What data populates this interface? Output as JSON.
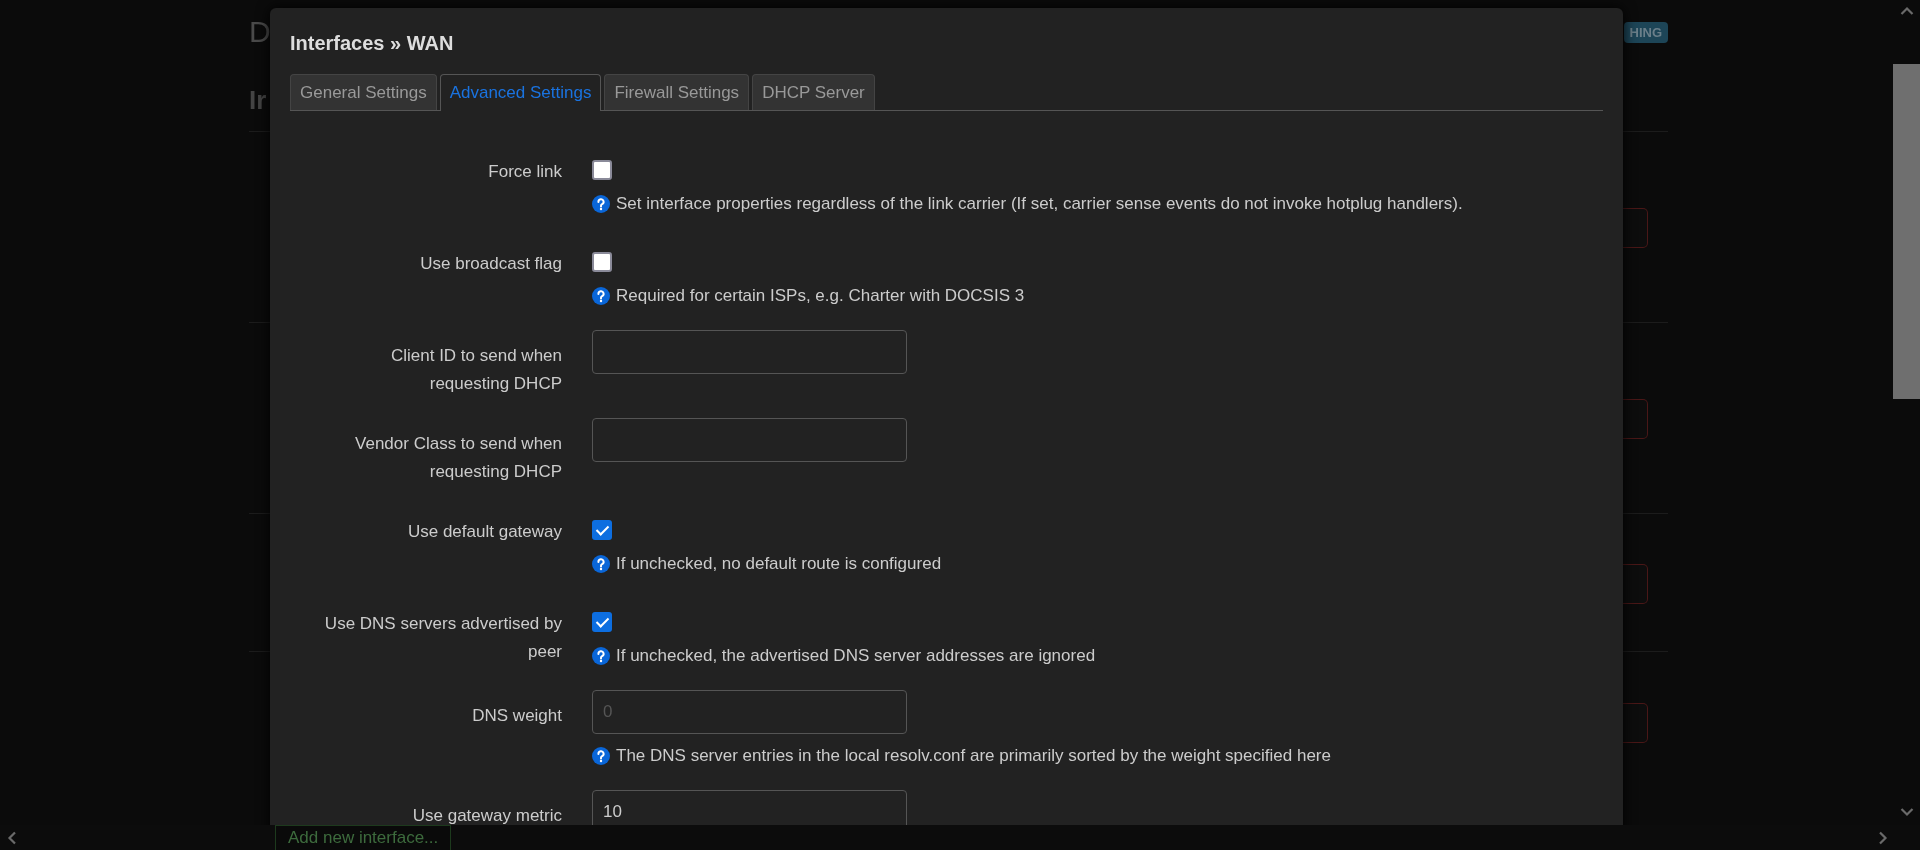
{
  "background": {
    "heading": "D",
    "subheading": "Ir",
    "badge": "HING",
    "add_button": "Add new interface..."
  },
  "modal": {
    "title": "Interfaces » WAN",
    "tabs": [
      {
        "label": "General Settings",
        "selected": false
      },
      {
        "label": "Advanced Settings",
        "selected": true
      },
      {
        "label": "Firewall Settings",
        "selected": false
      },
      {
        "label": "DHCP Server",
        "selected": false
      }
    ],
    "rows": [
      {
        "kind": "checkbox",
        "label": "Force link",
        "checked": false,
        "help": "Set interface properties regardless of the link carrier (If set, carrier sense events do not invoke hotplug handlers)."
      },
      {
        "kind": "checkbox",
        "label": "Use broadcast flag",
        "checked": false,
        "help": "Required for certain ISPs, e.g. Charter with DOCSIS 3"
      },
      {
        "kind": "text",
        "label": "Client ID to send when requesting DHCP"
      },
      {
        "kind": "text",
        "label": "Vendor Class to send when requesting DHCP"
      },
      {
        "kind": "checkbox",
        "label": "Use default gateway",
        "checked": true,
        "help": "If unchecked, no default route is configured"
      },
      {
        "kind": "checkbox",
        "label": "Use DNS servers advertised by peer",
        "checked": true,
        "help": "If unchecked, the advertised DNS server addresses are ignored"
      },
      {
        "kind": "text",
        "label": "DNS weight",
        "placeholder": "0",
        "help": "The DNS server entries in the local resolv.conf are primarily sorted by the weight specified here"
      },
      {
        "kind": "text",
        "label": "Use gateway metric",
        "value": "10"
      }
    ]
  }
}
